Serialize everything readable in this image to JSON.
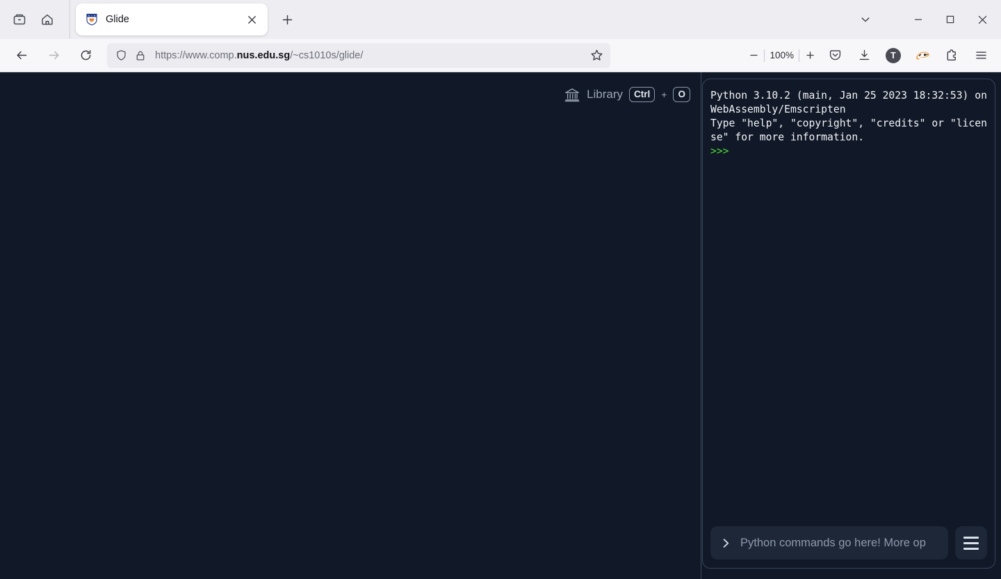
{
  "browser": {
    "tab": {
      "title": "Glide",
      "favicon_name": "nus-crest-favicon",
      "close_label": "✕"
    },
    "new_tab_label": "+",
    "window_controls": {
      "list_tabs_label": "⌄",
      "minimize_label": "—",
      "maximize_label": "▢",
      "close_label": "✕"
    },
    "nav": {
      "back_label": "←",
      "forward_label": "→",
      "reload_label": "⟳"
    },
    "urlbar": {
      "url_prefix": "https://www.comp.",
      "url_domain": "nus.edu.sg",
      "url_suffix": "/~cs1010s/glide/",
      "full_url": "https://www.comp.nus.edu.sg/~cs1010s/glide/",
      "shield_icon": "shield-icon",
      "lock_icon": "padlock-icon",
      "bookmark_icon": "star-icon"
    },
    "toolbar": {
      "zoom_out_label": "−",
      "zoom_level": "100%",
      "zoom_in_label": "+",
      "pocket_icon": "pocket-icon",
      "downloads_icon": "download-icon",
      "account_initial": "T",
      "extension_badger_icon": "privacy-badger-icon",
      "extensions_icon": "extensions-puzzle-icon",
      "app_menu_icon": "hamburger-menu-icon"
    },
    "toolbox_icon": "firefox-view-icon",
    "home_icon": "home-icon"
  },
  "app": {
    "library": {
      "label": "Library",
      "icon": "museum-bank-icon",
      "shortcut_modifier": "Ctrl",
      "shortcut_plus": "+",
      "shortcut_key": "O"
    },
    "terminal": {
      "output_lines": "Python 3.10.2 (main, Jan 25 2023 18:32:53) on WebAssembly/Emscripten\nType \"help\", \"copyright\", \"credits\" or \"license\" for more information.",
      "prompt": ">>>",
      "input_chevron": "chevron-right-icon",
      "input_value": "",
      "input_placeholder": "Python commands go here! More op",
      "menu_icon": "hamburger-menu-icon"
    },
    "colors": {
      "page_background": "#111827",
      "panel_border": "#39465c",
      "input_background": "#1d2738",
      "prompt_green": "#4ade35",
      "muted_text": "#8e99ab"
    }
  }
}
